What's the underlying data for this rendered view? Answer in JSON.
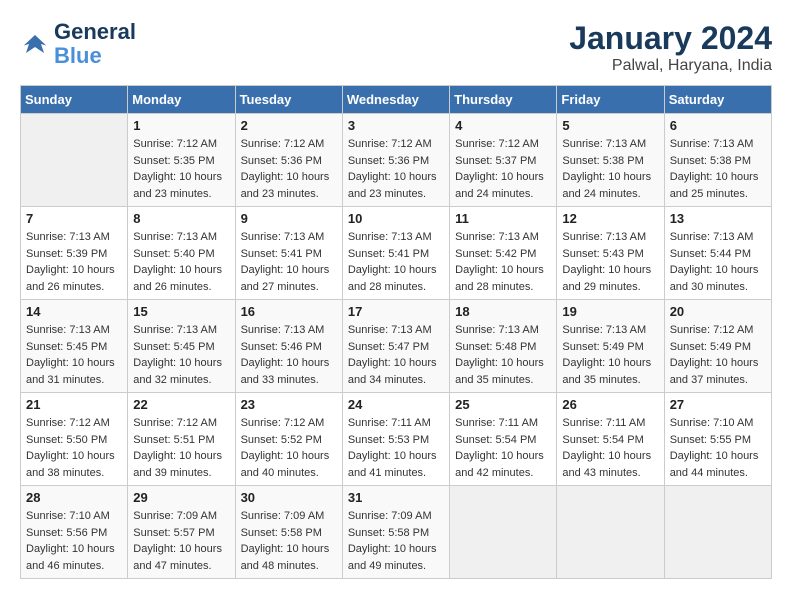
{
  "logo": {
    "text_general": "General",
    "text_blue": "Blue"
  },
  "title": "January 2024",
  "subtitle": "Palwal, Haryana, India",
  "headers": [
    "Sunday",
    "Monday",
    "Tuesday",
    "Wednesday",
    "Thursday",
    "Friday",
    "Saturday"
  ],
  "weeks": [
    [
      {
        "day": "",
        "sunrise": "",
        "sunset": "",
        "daylight": ""
      },
      {
        "day": "1",
        "sunrise": "Sunrise: 7:12 AM",
        "sunset": "Sunset: 5:35 PM",
        "daylight": "Daylight: 10 hours and 23 minutes."
      },
      {
        "day": "2",
        "sunrise": "Sunrise: 7:12 AM",
        "sunset": "Sunset: 5:36 PM",
        "daylight": "Daylight: 10 hours and 23 minutes."
      },
      {
        "day": "3",
        "sunrise": "Sunrise: 7:12 AM",
        "sunset": "Sunset: 5:36 PM",
        "daylight": "Daylight: 10 hours and 23 minutes."
      },
      {
        "day": "4",
        "sunrise": "Sunrise: 7:12 AM",
        "sunset": "Sunset: 5:37 PM",
        "daylight": "Daylight: 10 hours and 24 minutes."
      },
      {
        "day": "5",
        "sunrise": "Sunrise: 7:13 AM",
        "sunset": "Sunset: 5:38 PM",
        "daylight": "Daylight: 10 hours and 24 minutes."
      },
      {
        "day": "6",
        "sunrise": "Sunrise: 7:13 AM",
        "sunset": "Sunset: 5:38 PM",
        "daylight": "Daylight: 10 hours and 25 minutes."
      }
    ],
    [
      {
        "day": "7",
        "sunrise": "Sunrise: 7:13 AM",
        "sunset": "Sunset: 5:39 PM",
        "daylight": "Daylight: 10 hours and 26 minutes."
      },
      {
        "day": "8",
        "sunrise": "Sunrise: 7:13 AM",
        "sunset": "Sunset: 5:40 PM",
        "daylight": "Daylight: 10 hours and 26 minutes."
      },
      {
        "day": "9",
        "sunrise": "Sunrise: 7:13 AM",
        "sunset": "Sunset: 5:41 PM",
        "daylight": "Daylight: 10 hours and 27 minutes."
      },
      {
        "day": "10",
        "sunrise": "Sunrise: 7:13 AM",
        "sunset": "Sunset: 5:41 PM",
        "daylight": "Daylight: 10 hours and 28 minutes."
      },
      {
        "day": "11",
        "sunrise": "Sunrise: 7:13 AM",
        "sunset": "Sunset: 5:42 PM",
        "daylight": "Daylight: 10 hours and 28 minutes."
      },
      {
        "day": "12",
        "sunrise": "Sunrise: 7:13 AM",
        "sunset": "Sunset: 5:43 PM",
        "daylight": "Daylight: 10 hours and 29 minutes."
      },
      {
        "day": "13",
        "sunrise": "Sunrise: 7:13 AM",
        "sunset": "Sunset: 5:44 PM",
        "daylight": "Daylight: 10 hours and 30 minutes."
      }
    ],
    [
      {
        "day": "14",
        "sunrise": "Sunrise: 7:13 AM",
        "sunset": "Sunset: 5:45 PM",
        "daylight": "Daylight: 10 hours and 31 minutes."
      },
      {
        "day": "15",
        "sunrise": "Sunrise: 7:13 AM",
        "sunset": "Sunset: 5:45 PM",
        "daylight": "Daylight: 10 hours and 32 minutes."
      },
      {
        "day": "16",
        "sunrise": "Sunrise: 7:13 AM",
        "sunset": "Sunset: 5:46 PM",
        "daylight": "Daylight: 10 hours and 33 minutes."
      },
      {
        "day": "17",
        "sunrise": "Sunrise: 7:13 AM",
        "sunset": "Sunset: 5:47 PM",
        "daylight": "Daylight: 10 hours and 34 minutes."
      },
      {
        "day": "18",
        "sunrise": "Sunrise: 7:13 AM",
        "sunset": "Sunset: 5:48 PM",
        "daylight": "Daylight: 10 hours and 35 minutes."
      },
      {
        "day": "19",
        "sunrise": "Sunrise: 7:13 AM",
        "sunset": "Sunset: 5:49 PM",
        "daylight": "Daylight: 10 hours and 35 minutes."
      },
      {
        "day": "20",
        "sunrise": "Sunrise: 7:12 AM",
        "sunset": "Sunset: 5:49 PM",
        "daylight": "Daylight: 10 hours and 37 minutes."
      }
    ],
    [
      {
        "day": "21",
        "sunrise": "Sunrise: 7:12 AM",
        "sunset": "Sunset: 5:50 PM",
        "daylight": "Daylight: 10 hours and 38 minutes."
      },
      {
        "day": "22",
        "sunrise": "Sunrise: 7:12 AM",
        "sunset": "Sunset: 5:51 PM",
        "daylight": "Daylight: 10 hours and 39 minutes."
      },
      {
        "day": "23",
        "sunrise": "Sunrise: 7:12 AM",
        "sunset": "Sunset: 5:52 PM",
        "daylight": "Daylight: 10 hours and 40 minutes."
      },
      {
        "day": "24",
        "sunrise": "Sunrise: 7:11 AM",
        "sunset": "Sunset: 5:53 PM",
        "daylight": "Daylight: 10 hours and 41 minutes."
      },
      {
        "day": "25",
        "sunrise": "Sunrise: 7:11 AM",
        "sunset": "Sunset: 5:54 PM",
        "daylight": "Daylight: 10 hours and 42 minutes."
      },
      {
        "day": "26",
        "sunrise": "Sunrise: 7:11 AM",
        "sunset": "Sunset: 5:54 PM",
        "daylight": "Daylight: 10 hours and 43 minutes."
      },
      {
        "day": "27",
        "sunrise": "Sunrise: 7:10 AM",
        "sunset": "Sunset: 5:55 PM",
        "daylight": "Daylight: 10 hours and 44 minutes."
      }
    ],
    [
      {
        "day": "28",
        "sunrise": "Sunrise: 7:10 AM",
        "sunset": "Sunset: 5:56 PM",
        "daylight": "Daylight: 10 hours and 46 minutes."
      },
      {
        "day": "29",
        "sunrise": "Sunrise: 7:09 AM",
        "sunset": "Sunset: 5:57 PM",
        "daylight": "Daylight: 10 hours and 47 minutes."
      },
      {
        "day": "30",
        "sunrise": "Sunrise: 7:09 AM",
        "sunset": "Sunset: 5:58 PM",
        "daylight": "Daylight: 10 hours and 48 minutes."
      },
      {
        "day": "31",
        "sunrise": "Sunrise: 7:09 AM",
        "sunset": "Sunset: 5:58 PM",
        "daylight": "Daylight: 10 hours and 49 minutes."
      },
      {
        "day": "",
        "sunrise": "",
        "sunset": "",
        "daylight": ""
      },
      {
        "day": "",
        "sunrise": "",
        "sunset": "",
        "daylight": ""
      },
      {
        "day": "",
        "sunrise": "",
        "sunset": "",
        "daylight": ""
      }
    ]
  ]
}
